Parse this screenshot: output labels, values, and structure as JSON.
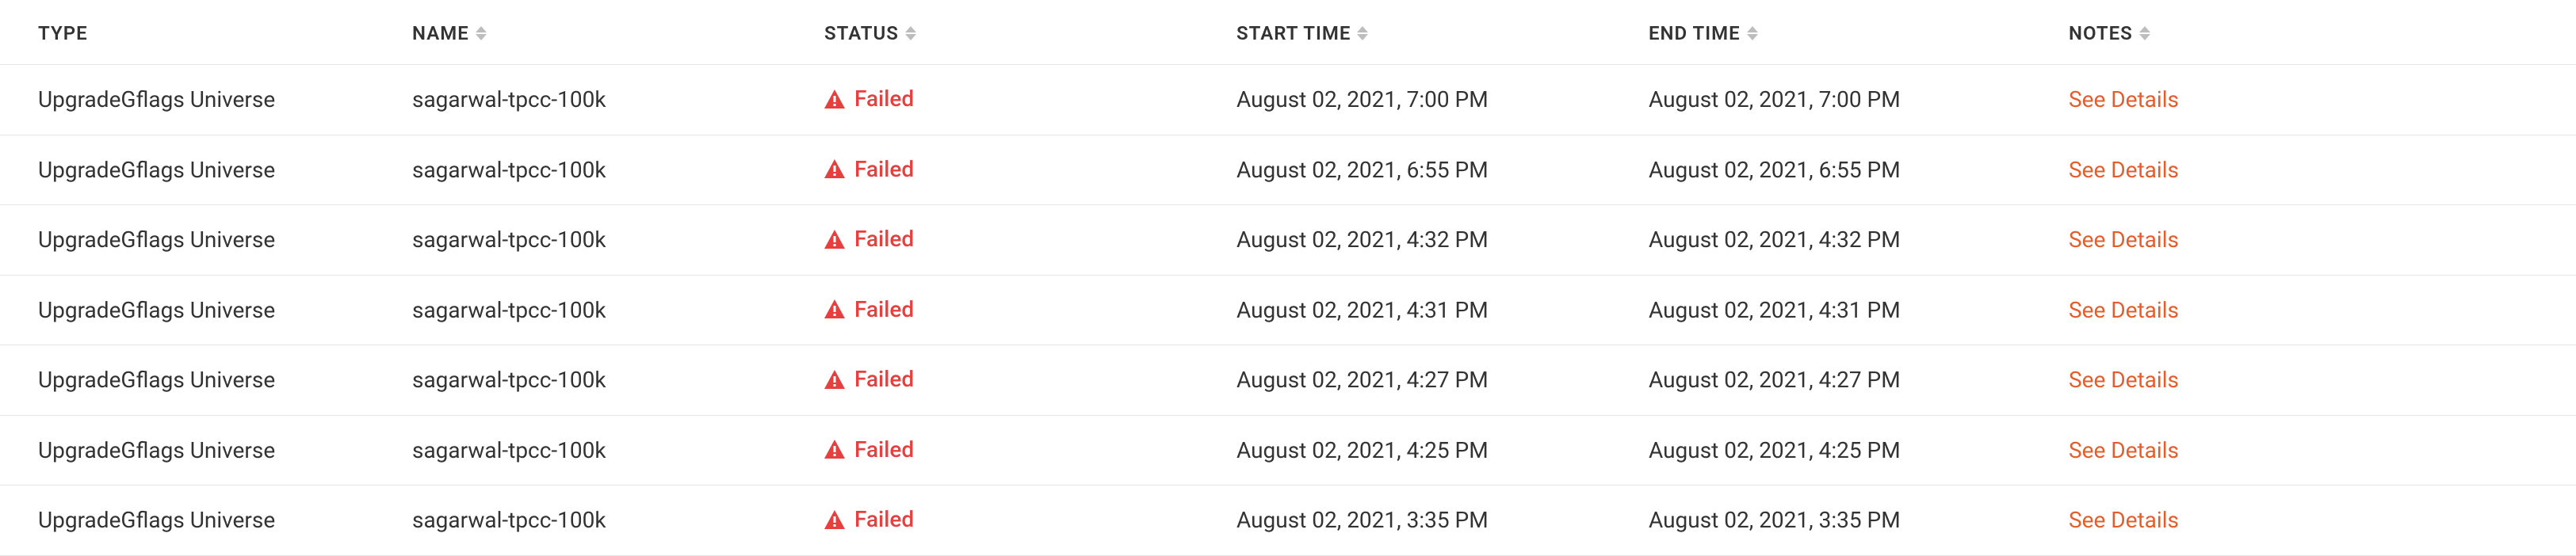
{
  "columns": {
    "type": {
      "label": "TYPE",
      "sortable": false
    },
    "name": {
      "label": "NAME",
      "sortable": true
    },
    "status": {
      "label": "STATUS",
      "sortable": true
    },
    "start": {
      "label": "START TIME",
      "sortable": true
    },
    "end": {
      "label": "END TIME",
      "sortable": true
    },
    "notes": {
      "label": "NOTES",
      "sortable": true
    }
  },
  "status_label": "Failed",
  "details_label": "See Details",
  "rows": [
    {
      "type": "UpgradeGflags Universe",
      "name": "sagarwal-tpcc-100k",
      "start": "August 02, 2021, 7:00 PM",
      "end": "August 02, 2021, 7:00 PM"
    },
    {
      "type": "UpgradeGflags Universe",
      "name": "sagarwal-tpcc-100k",
      "start": "August 02, 2021, 6:55 PM",
      "end": "August 02, 2021, 6:55 PM"
    },
    {
      "type": "UpgradeGflags Universe",
      "name": "sagarwal-tpcc-100k",
      "start": "August 02, 2021, 4:32 PM",
      "end": "August 02, 2021, 4:32 PM"
    },
    {
      "type": "UpgradeGflags Universe",
      "name": "sagarwal-tpcc-100k",
      "start": "August 02, 2021, 4:31 PM",
      "end": "August 02, 2021, 4:31 PM"
    },
    {
      "type": "UpgradeGflags Universe",
      "name": "sagarwal-tpcc-100k",
      "start": "August 02, 2021, 4:27 PM",
      "end": "August 02, 2021, 4:27 PM"
    },
    {
      "type": "UpgradeGflags Universe",
      "name": "sagarwal-tpcc-100k",
      "start": "August 02, 2021, 4:25 PM",
      "end": "August 02, 2021, 4:25 PM"
    },
    {
      "type": "UpgradeGflags Universe",
      "name": "sagarwal-tpcc-100k",
      "start": "August 02, 2021, 3:35 PM",
      "end": "August 02, 2021, 3:35 PM"
    }
  ],
  "colors": {
    "danger": "#e73e3e",
    "link": "#e55d2b"
  }
}
